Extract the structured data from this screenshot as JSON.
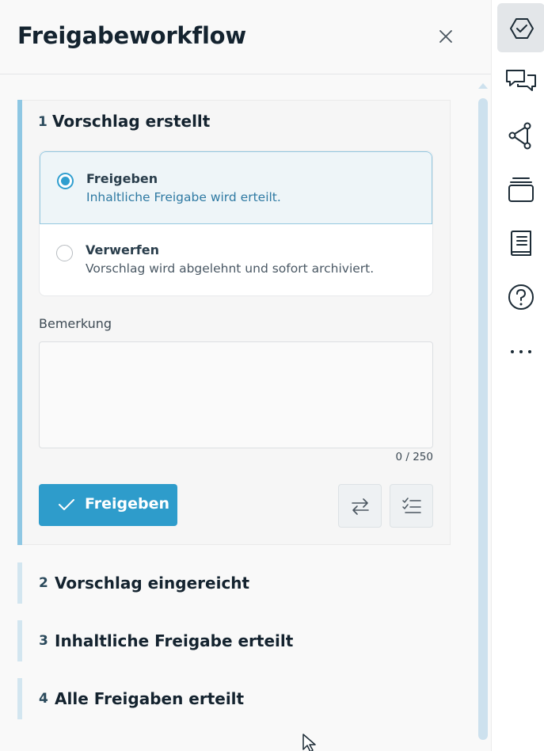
{
  "panel": {
    "title": "Freigabeworkflow"
  },
  "steps": [
    {
      "number": "1",
      "title": "Vorschlag erstellt",
      "options": [
        {
          "label": "Freigeben",
          "description": "Inhaltliche Freigabe wird erteilt.",
          "selected": true
        },
        {
          "label": "Verwerfen",
          "description": "Vorschlag wird abgelehnt und sofort archiviert.",
          "selected": false
        }
      ],
      "remark_label": "Bemerkung",
      "remark_value": "",
      "char_count": "0 / 250",
      "submit_label": "Freigeben"
    },
    {
      "number": "2",
      "title": "Vorschlag eingereicht"
    },
    {
      "number": "3",
      "title": "Inhaltliche Freigabe erteilt"
    },
    {
      "number": "4",
      "title": "Alle Freigaben erteilt"
    }
  ],
  "rail_icons": [
    "workflow-check-icon",
    "comments-icon",
    "share-network-icon",
    "layers-icon",
    "book-icon",
    "help-icon",
    "more-icon"
  ],
  "colors": {
    "accent": "#2e9ccb",
    "accent_light": "#8ec7e3",
    "selected_bg": "#eef5f8",
    "text_dark": "#14232f"
  }
}
